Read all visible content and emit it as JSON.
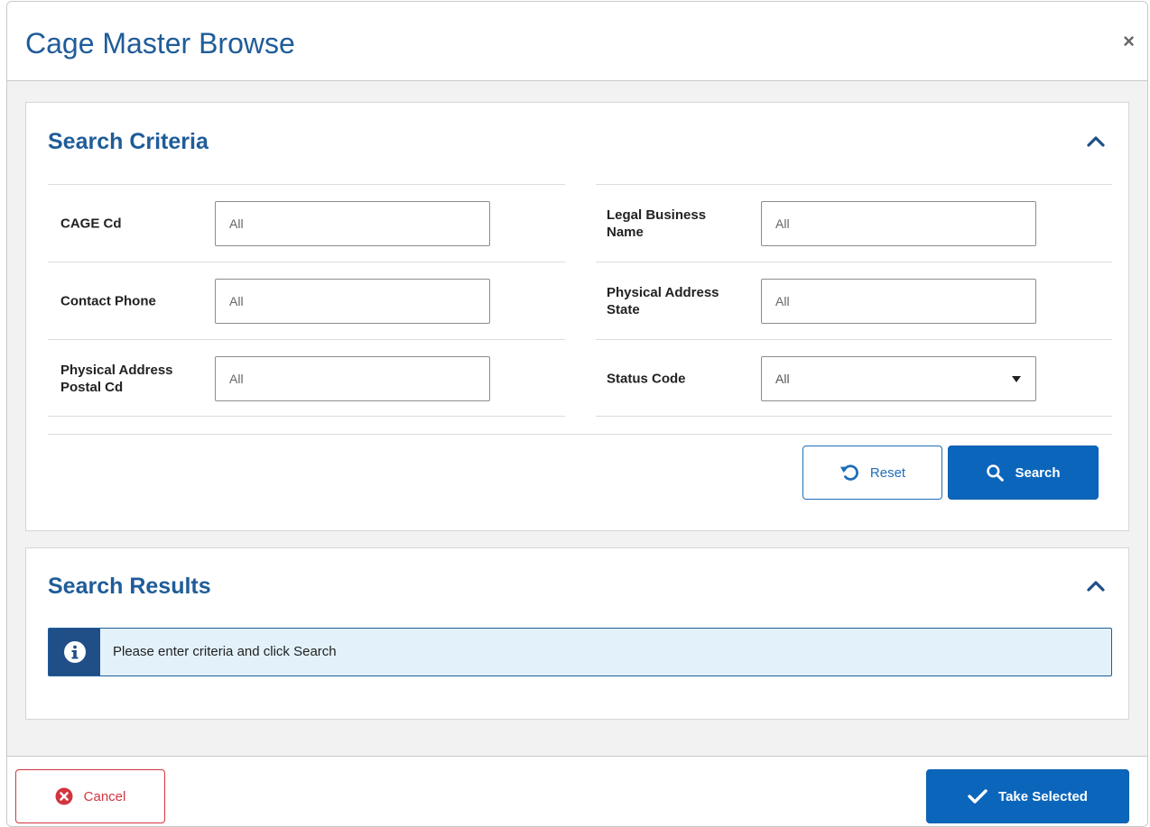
{
  "modal": {
    "title": "Cage Master Browse",
    "close_symbol": "×"
  },
  "search_criteria": {
    "title": "Search Criteria",
    "chevron_icon": "chevron-up-icon",
    "fields_left": [
      {
        "label": "CAGE Cd",
        "placeholder": "All"
      },
      {
        "label": "Contact Phone",
        "placeholder": "All"
      },
      {
        "label": "Physical Address Postal Cd",
        "placeholder": "All"
      }
    ],
    "fields_right": [
      {
        "label": "Legal Business Name",
        "placeholder": "All"
      },
      {
        "label": "Physical Address State",
        "placeholder": "All"
      },
      {
        "label": "Status Code",
        "selected": "All"
      }
    ],
    "reset_label": "Reset",
    "search_label": "Search"
  },
  "search_results": {
    "title": "Search Results",
    "chevron_icon": "chevron-up-icon",
    "info_message": "Please enter criteria and click Search"
  },
  "footer": {
    "cancel_label": "Cancel",
    "take_selected_label": "Take Selected"
  },
  "colors": {
    "title_blue": "#1f5c99",
    "primary_button": "#0b66bb",
    "danger": "#d23540",
    "info_background": "#e3f2fa",
    "info_icon_background": "#1f4f86"
  }
}
